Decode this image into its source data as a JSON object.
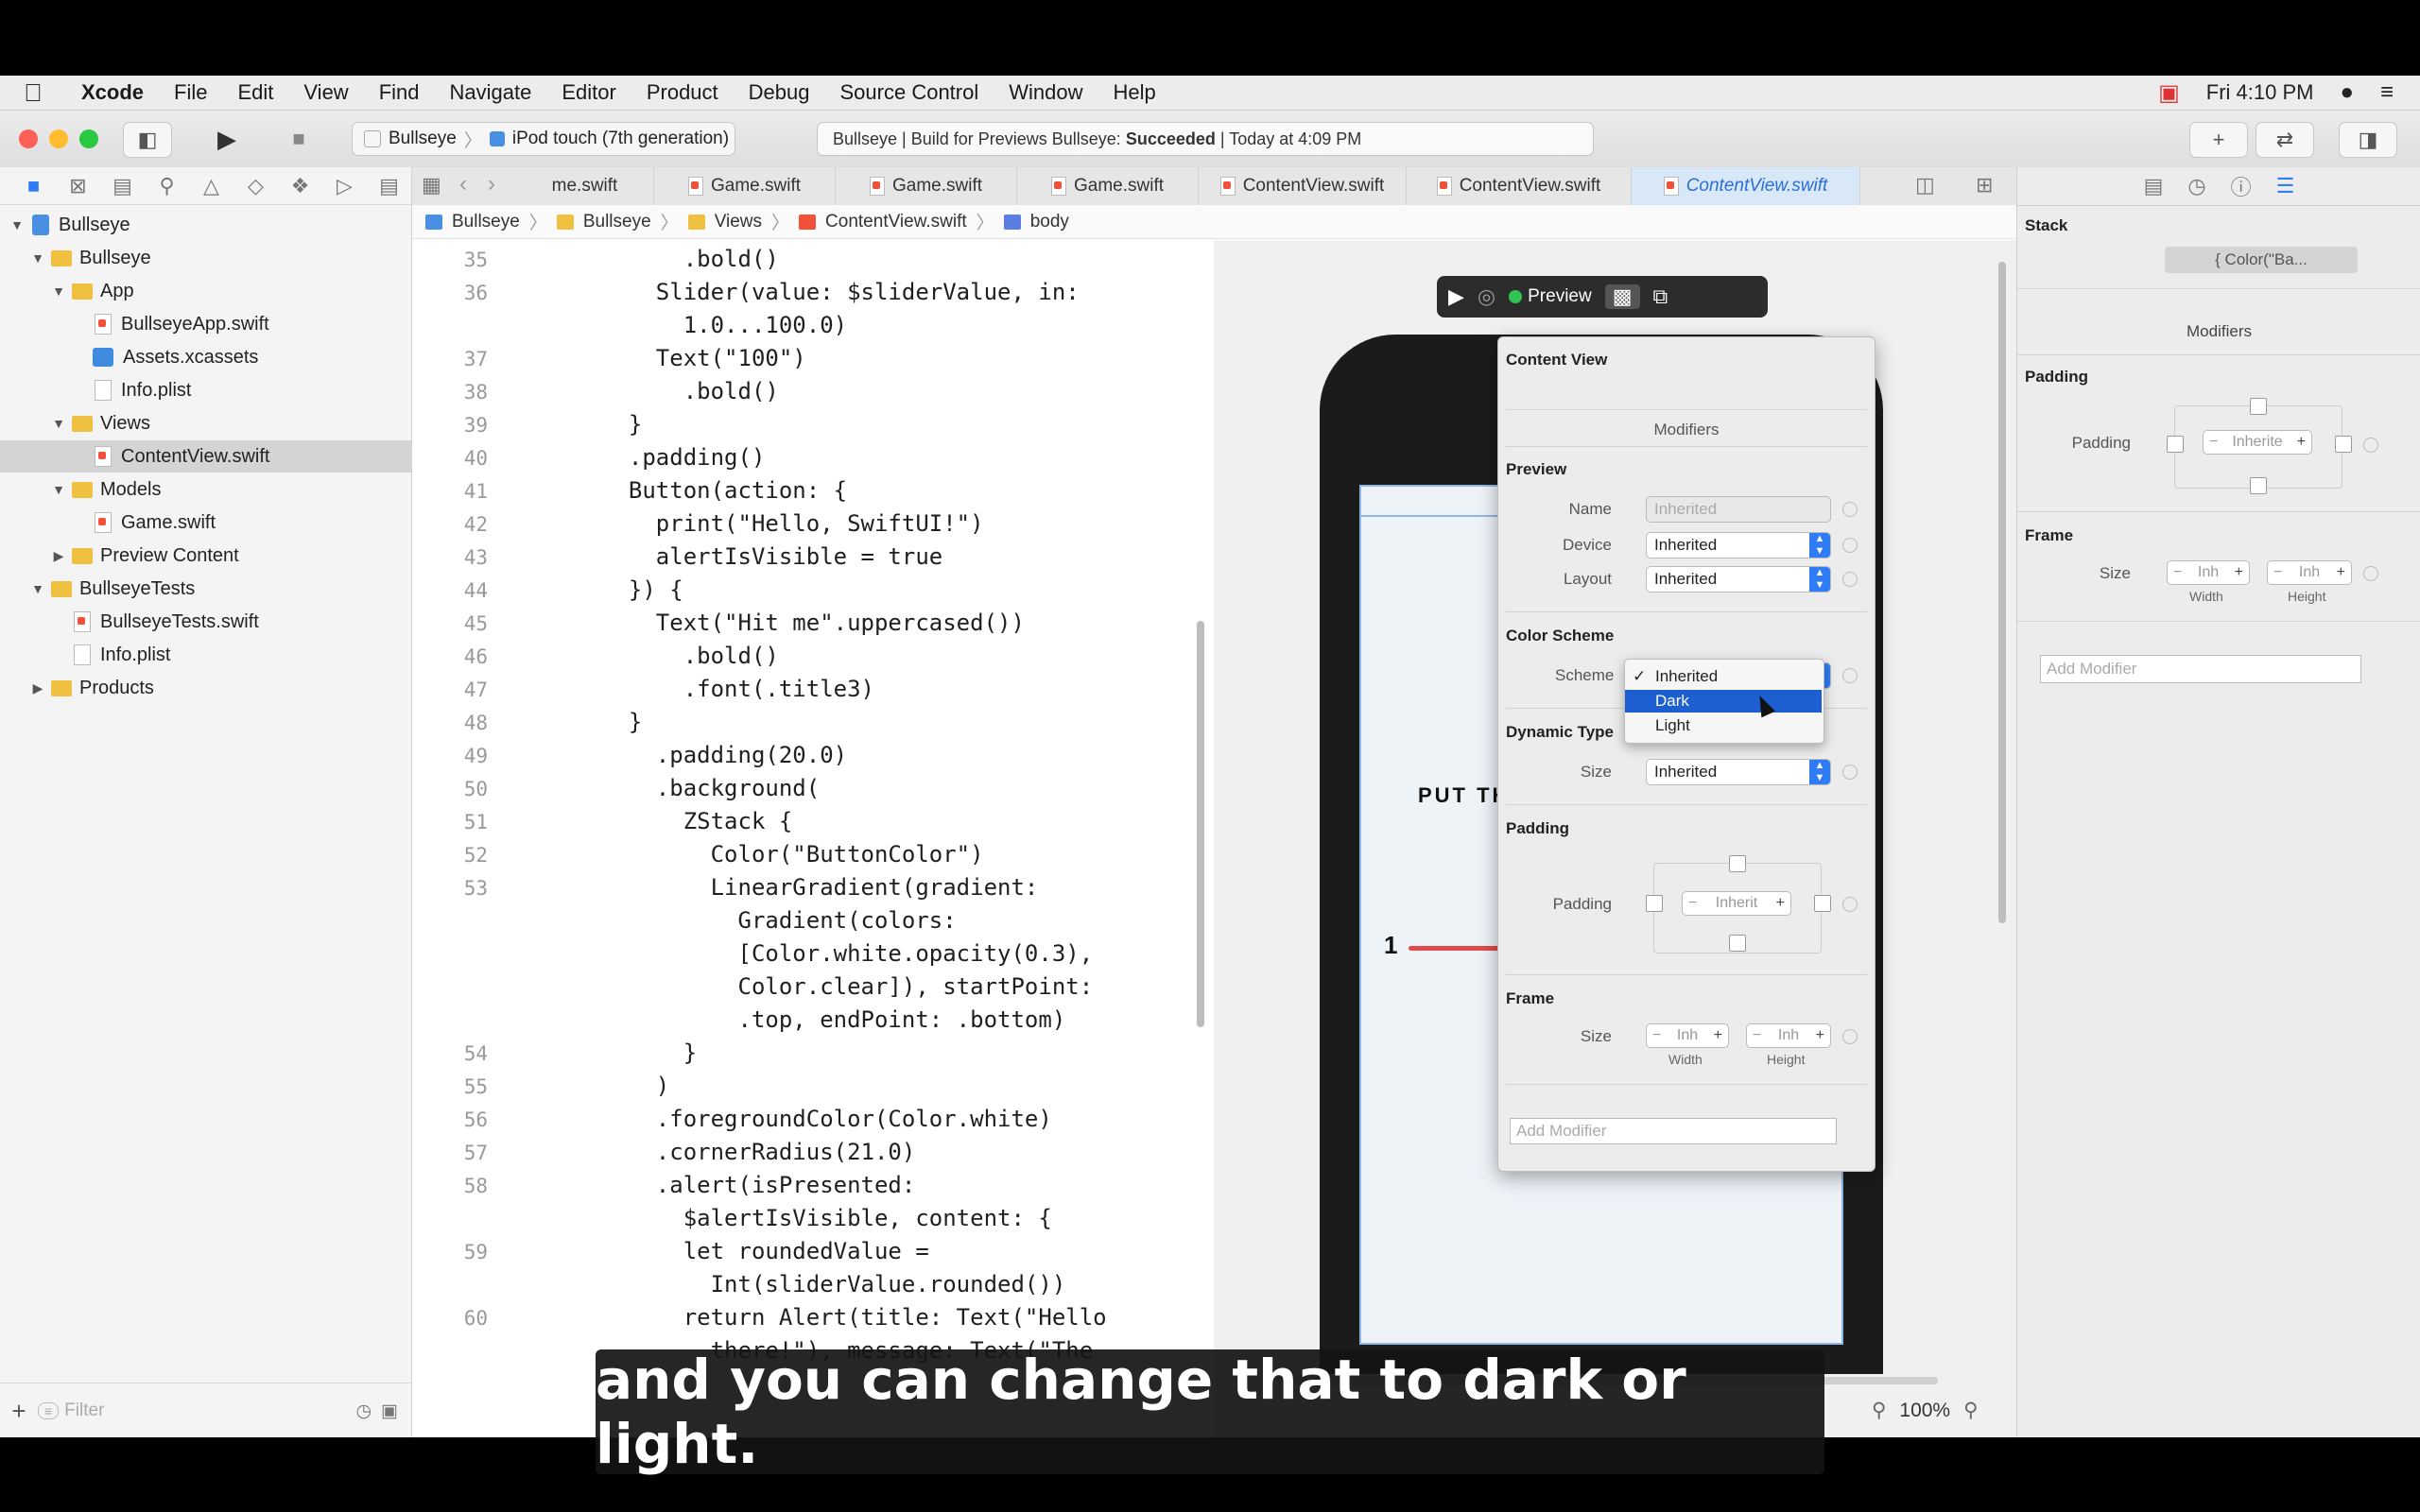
{
  "menubar": {
    "apple": "",
    "app": "Xcode",
    "items": [
      "File",
      "Edit",
      "View",
      "Find",
      "Navigate",
      "Editor",
      "Product",
      "Debug",
      "Source Control",
      "Window",
      "Help"
    ],
    "clock": "Fri 4:10 PM"
  },
  "toolbar": {
    "scheme_target": "Bullseye",
    "scheme_device": "iPod touch (7th generation)",
    "activity_prefix": "Bullseye | Build for Previews Bullseye: ",
    "activity_status": "Succeeded",
    "activity_suffix": " | Today at 4:09 PM"
  },
  "navigator": {
    "items": [
      {
        "label": "Bullseye",
        "depth": 0,
        "kind": "project",
        "disclosure": "▼"
      },
      {
        "label": "Bullseye",
        "depth": 1,
        "kind": "folder",
        "disclosure": "▼"
      },
      {
        "label": "App",
        "depth": 2,
        "kind": "folder",
        "disclosure": "▼"
      },
      {
        "label": "BullseyeApp.swift",
        "depth": 3,
        "kind": "swift",
        "disclosure": ""
      },
      {
        "label": "Assets.xcassets",
        "depth": 3,
        "kind": "assets",
        "disclosure": ""
      },
      {
        "label": "Info.plist",
        "depth": 3,
        "kind": "plist",
        "disclosure": ""
      },
      {
        "label": "Views",
        "depth": 2,
        "kind": "folder",
        "disclosure": "▼"
      },
      {
        "label": "ContentView.swift",
        "depth": 3,
        "kind": "swift",
        "disclosure": "",
        "selected": true
      },
      {
        "label": "Models",
        "depth": 2,
        "kind": "folder",
        "disclosure": "▼"
      },
      {
        "label": "Game.swift",
        "depth": 3,
        "kind": "swift",
        "disclosure": ""
      },
      {
        "label": "Preview Content",
        "depth": 2,
        "kind": "folder",
        "disclosure": "▶"
      },
      {
        "label": "BullseyeTests",
        "depth": 1,
        "kind": "folder",
        "disclosure": "▼"
      },
      {
        "label": "BullseyeTests.swift",
        "depth": 2,
        "kind": "swift",
        "disclosure": ""
      },
      {
        "label": "Info.plist",
        "depth": 2,
        "kind": "plist",
        "disclosure": ""
      },
      {
        "label": "Products",
        "depth": 1,
        "kind": "folder",
        "disclosure": "▶"
      }
    ],
    "filter_placeholder": "Filter"
  },
  "tabs": [
    "me.swift",
    "Game.swift",
    "Game.swift",
    "Game.swift",
    "ContentView.swift",
    "ContentView.swift",
    "ContentView.swift"
  ],
  "jumpbar": [
    "Bullseye",
    "Bullseye",
    "Views",
    "ContentView.swift",
    "body"
  ],
  "code": {
    "lines": [
      {
        "n": "35",
        "t": "      .bold()"
      },
      {
        "n": "36",
        "t": "    Slider(value: $sliderValue, in:"
      },
      {
        "n": "",
        "t": "      1.0...100.0)"
      },
      {
        "n": "37",
        "t": "    Text(\"100\")"
      },
      {
        "n": "38",
        "t": "      .bold()"
      },
      {
        "n": "39",
        "t": "  }"
      },
      {
        "n": "40",
        "t": "  .padding()"
      },
      {
        "n": "41",
        "t": "  Button(action: {"
      },
      {
        "n": "42",
        "t": "    print(\"Hello, SwiftUI!\")"
      },
      {
        "n": "43",
        "t": "    alertIsVisible = true"
      },
      {
        "n": "44",
        "t": "  }) {"
      },
      {
        "n": "45",
        "t": "    Text(\"Hit me\".uppercased())"
      },
      {
        "n": "46",
        "t": "      .bold()"
      },
      {
        "n": "47",
        "t": "      .font(.title3)"
      },
      {
        "n": "48",
        "t": "  }"
      },
      {
        "n": "49",
        "t": "    .padding(20.0)"
      },
      {
        "n": "50",
        "t": "    .background("
      },
      {
        "n": "51",
        "t": "      ZStack {"
      },
      {
        "n": "52",
        "t": "        Color(\"ButtonColor\")"
      },
      {
        "n": "53",
        "t": "        LinearGradient(gradient:"
      },
      {
        "n": "",
        "t": "          Gradient(colors:"
      },
      {
        "n": "",
        "t": "          [Color.white.opacity(0.3),"
      },
      {
        "n": "",
        "t": "          Color.clear]), startPoint:"
      },
      {
        "n": "",
        "t": "          .top, endPoint: .bottom)"
      },
      {
        "n": "54",
        "t": "      }"
      },
      {
        "n": "55",
        "t": "    )"
      },
      {
        "n": "56",
        "t": "    .foregroundColor(Color.white)"
      },
      {
        "n": "57",
        "t": "    .cornerRadius(21.0)"
      },
      {
        "n": "58",
        "t": "    .alert(isPresented:"
      },
      {
        "n": "",
        "t": "      $alertIsVisible, content: {"
      },
      {
        "n": "59",
        "t": "      let roundedValue ="
      },
      {
        "n": "",
        "t": "        Int(sliderValue.rounded())"
      },
      {
        "n": "60",
        "t": "      return Alert(title: Text(\"Hello"
      },
      {
        "n": "",
        "t": "        there!\"), message: Text(\"The"
      }
    ]
  },
  "preview": {
    "toolbar_label": "Preview",
    "screen_text": "PUT TH",
    "slider_min": "1"
  },
  "popover": {
    "title": "Content View",
    "modifiers_label": "Modifiers",
    "preview_header": "Preview",
    "name_label": "Name",
    "name_value": "Inherited",
    "device_label": "Device",
    "device_value": "Inherited",
    "layout_label": "Layout",
    "layout_value": "Inherited",
    "color_scheme_header": "Color Scheme",
    "scheme_label": "Scheme",
    "dynamic_type_header": "Dynamic Type",
    "size_label": "Size",
    "size_value": "Inherited",
    "padding_header": "Padding",
    "padding_label": "Padding",
    "padding_value": "Inherit",
    "frame_header": "Frame",
    "frame_size_label": "Size",
    "frame_w": "Inh",
    "frame_h": "Inh",
    "width_label": "Width",
    "height_label": "Height",
    "add_modifier": "Add Modifier"
  },
  "scheme_menu": {
    "options": [
      "Inherited",
      "Dark",
      "Light"
    ],
    "checked": "Inherited",
    "highlighted": "Dark"
  },
  "inspector": {
    "stack_label": "Stack",
    "stack_value": "{ Color(\"Ba...",
    "modifiers_label": "Modifiers",
    "padding_header": "Padding",
    "padding_label": "Padding",
    "padding_value": "Inherite",
    "frame_header": "Frame",
    "size_label": "Size",
    "frame_w": "Inh",
    "frame_h": "Inh",
    "width_label": "Width",
    "height_label": "Height",
    "add_modifier": "Add Modifier"
  },
  "canvas_footer": {
    "zoom": "100%"
  },
  "caption": "and you can change that to dark or light."
}
